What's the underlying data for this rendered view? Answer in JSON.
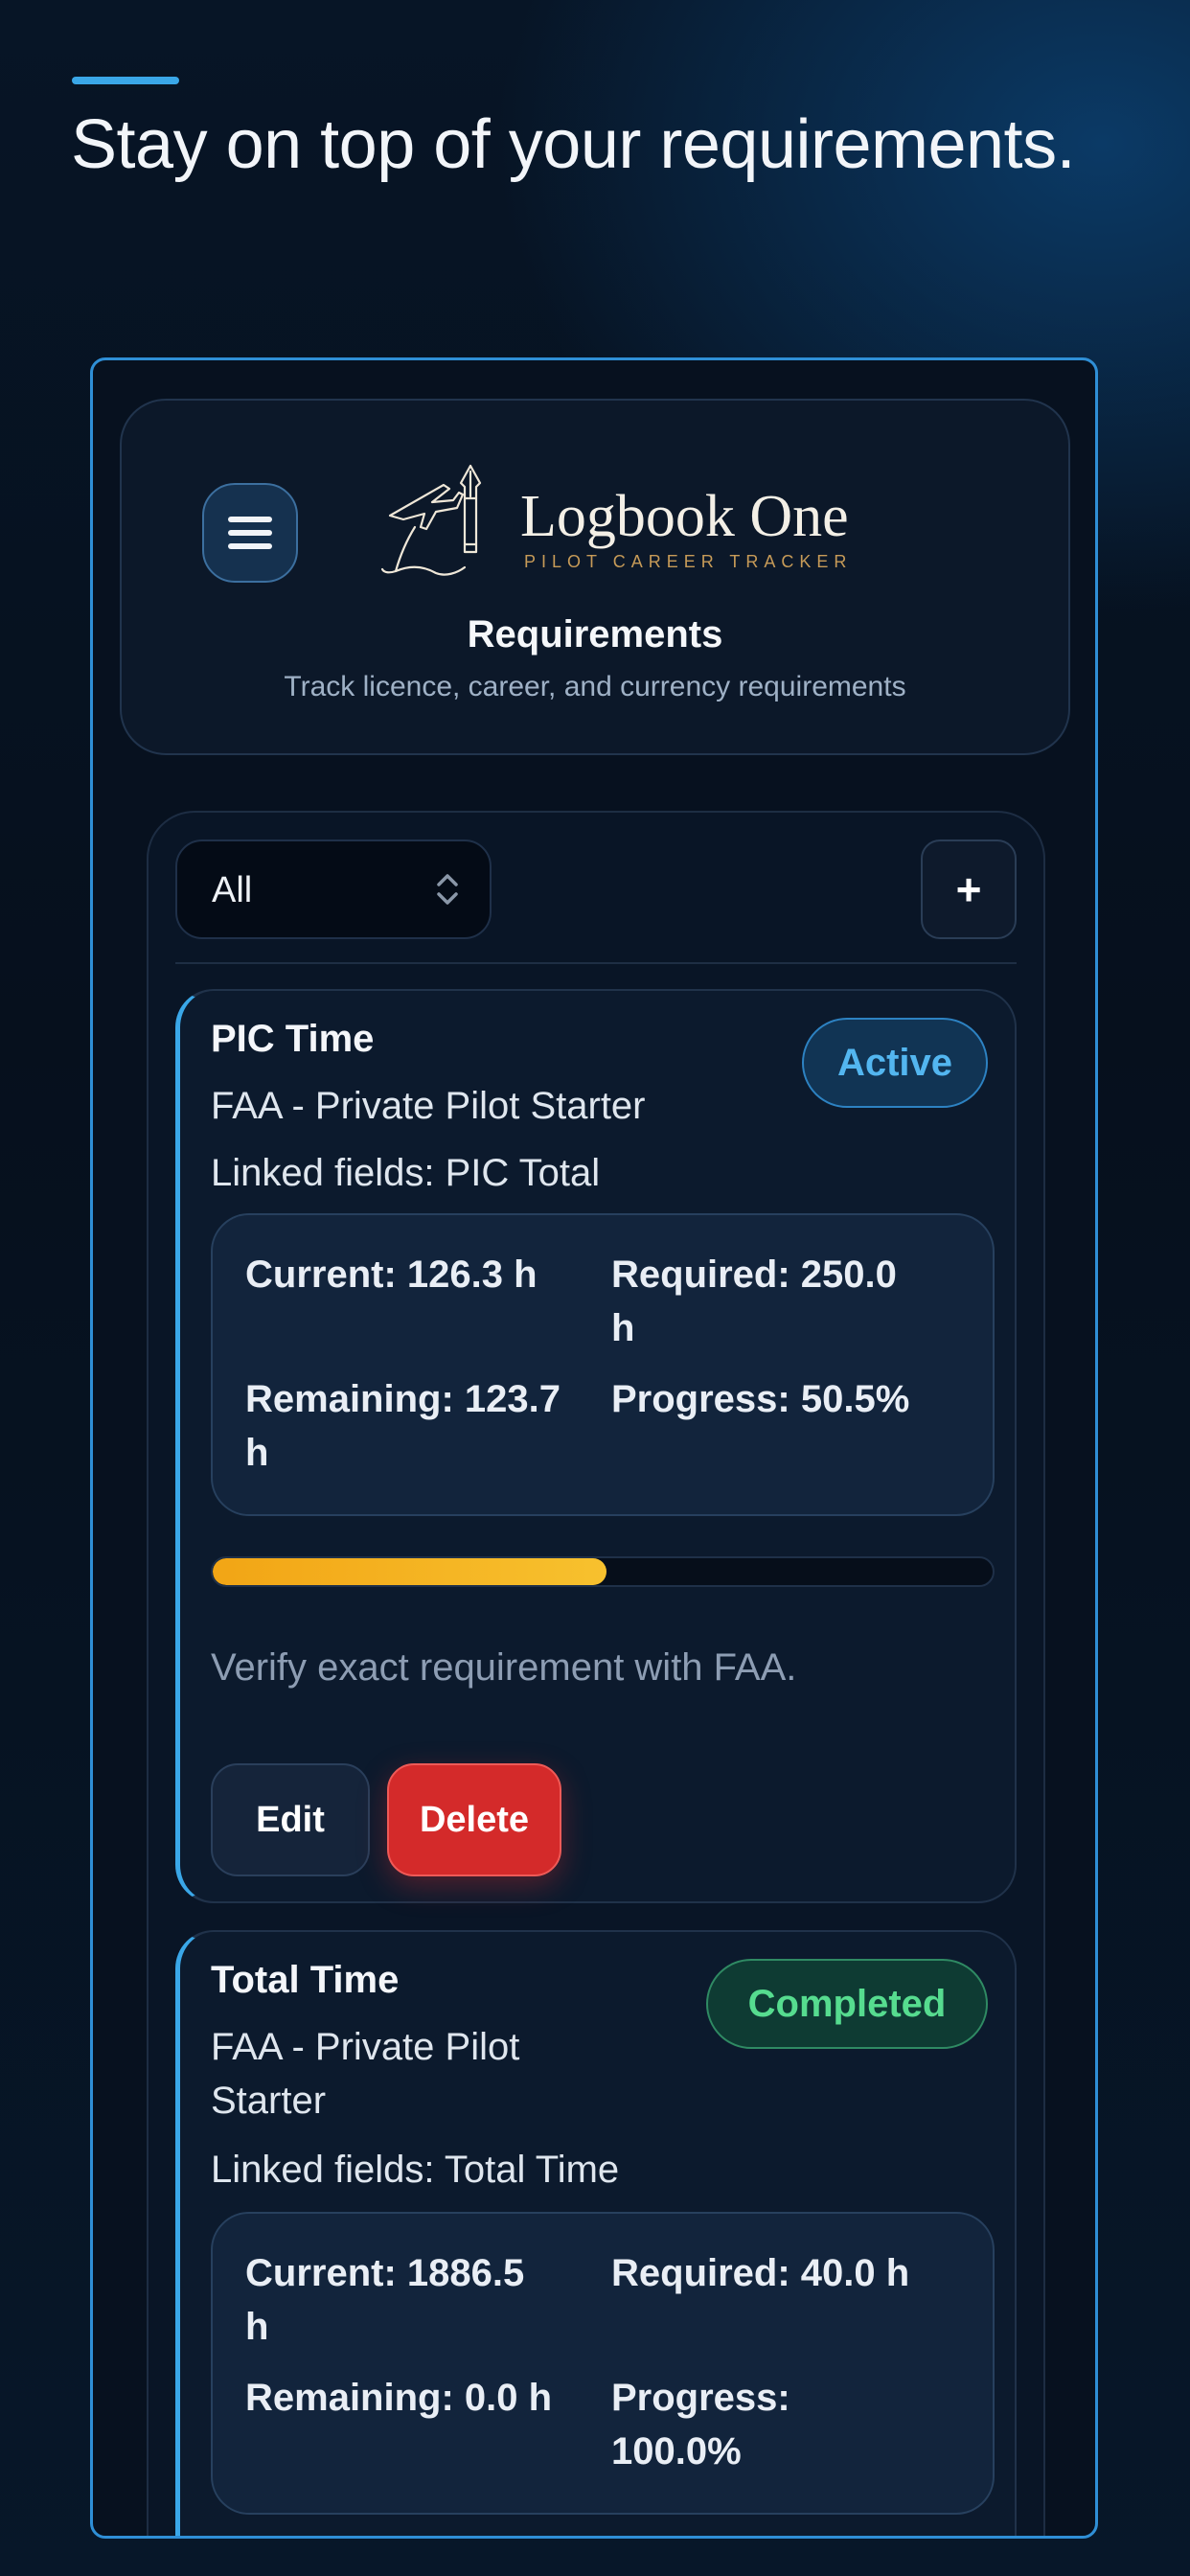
{
  "headline": "Stay on top of your requirements.",
  "app": {
    "logo_name": "Logbook One",
    "logo_tagline": "PILOT CAREER TRACKER",
    "menu_icon": "hamburger-menu-icon"
  },
  "page": {
    "title": "Requirements",
    "subtitle": "Track licence, career, and currency requirements"
  },
  "toolbar": {
    "filter_value": "All",
    "add_label": "+"
  },
  "requirements": [
    {
      "title": "PIC Time",
      "program": "FAA - Private Pilot Starter",
      "linked": "Linked fields: PIC Total",
      "status": "Active",
      "current": "Current: 126.3 h",
      "required_line1": "Required: 250.0",
      "required_line2": "h",
      "remaining_line1": "Remaining: 123.7",
      "remaining_line2": "h",
      "progress": "Progress: 50.5%",
      "progress_fraction": 0.505,
      "note": "Verify exact requirement with FAA.",
      "edit_label": "Edit",
      "delete_label": "Delete"
    },
    {
      "title": "Total Time",
      "program_line1": "FAA - Private Pilot",
      "program_line2": "Starter",
      "linked": "Linked fields: Total Time",
      "status": "Completed",
      "current_line1": "Current: 1886.5",
      "current_line2": "h",
      "required": "Required: 40.0 h",
      "remaining": "Remaining: 0.0 h",
      "progress_line1": "Progress:",
      "progress_line2": "100.0%"
    }
  ],
  "colors": {
    "accent": "#3aa7e8",
    "active": "#53b6f0",
    "completed": "#56dc8f",
    "progress": "#f7c12e",
    "danger": "#d42a2a"
  }
}
